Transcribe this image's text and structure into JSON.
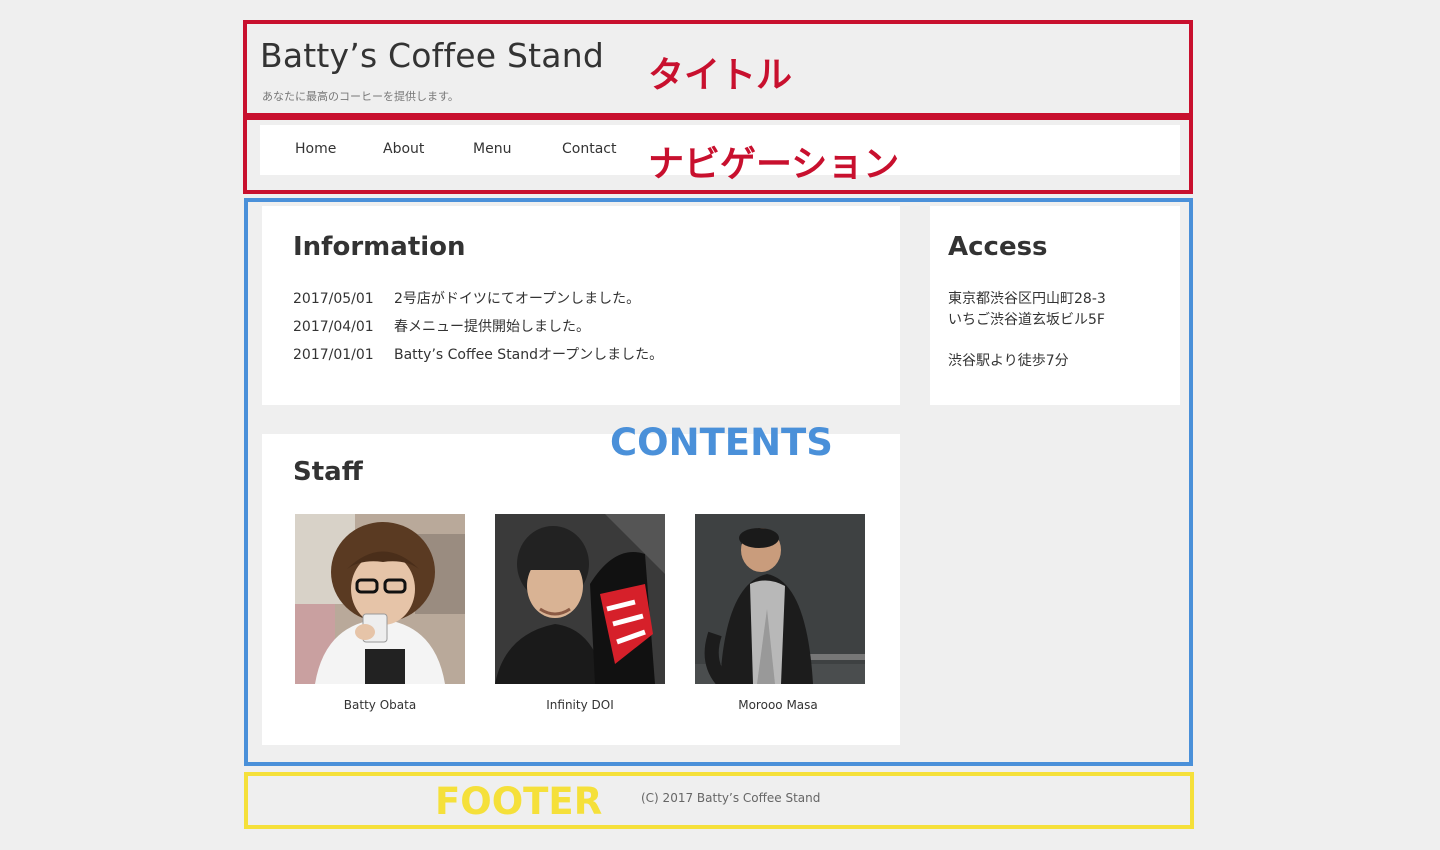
{
  "header": {
    "title": "Batty’s Coffee Stand",
    "tagline": "あなたに最高のコーヒーを提供します。"
  },
  "nav": {
    "items": [
      {
        "label": "Home"
      },
      {
        "label": "About"
      },
      {
        "label": "Menu"
      },
      {
        "label": "Contact"
      }
    ]
  },
  "information": {
    "heading": "Information",
    "items": [
      {
        "date": "2017/05/01",
        "text": "2号店がドイツにてオープンしました。"
      },
      {
        "date": "2017/04/01",
        "text": "春メニュー提供開始しました。"
      },
      {
        "date": "2017/01/01",
        "text": "Batty’s Coffee Standオープンしました。"
      }
    ]
  },
  "access": {
    "heading": "Access",
    "address_line1": "東京都渋谷区円山町28-3",
    "address_line2": "いちご渋谷道玄坂ビル5F",
    "directions": "渋谷駅より徒歩7分"
  },
  "staff": {
    "heading": "Staff",
    "members": [
      {
        "name": "Batty Obata"
      },
      {
        "name": "Infinity DOI"
      },
      {
        "name": "Morooo  Masa"
      }
    ]
  },
  "footer": {
    "copyright": "(C) 2017 Batty’s Coffee Stand"
  },
  "annotations": {
    "title_label": "タイトル",
    "nav_label": "ナビゲーション",
    "contents_label": "CONTENTS",
    "footer_label": "FOOTER"
  },
  "colors": {
    "page_background": "#efefef",
    "annotation_red": "#c8102e",
    "annotation_blue": "#4a90d9",
    "annotation_yellow": "#f5e03a",
    "panel_background": "#ffffff"
  }
}
